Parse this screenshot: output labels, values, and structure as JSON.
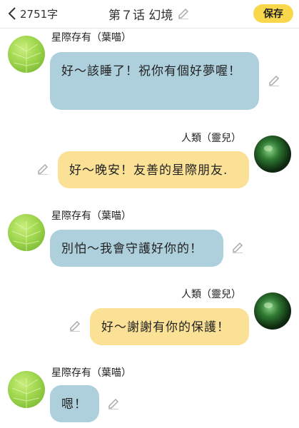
{
  "header": {
    "word_count": "2751字",
    "title": "第７话 幻境",
    "save_label": "保存"
  },
  "icons": {
    "back": "chevron-left-icon",
    "edit": "pencil-icon"
  },
  "colors": {
    "accent": "#f8d84a",
    "ai_bubble": "#aecfdc",
    "user_bubble": "#fbe195"
  },
  "messages": [
    {
      "side": "left",
      "speaker": "星際存有（葉喵）",
      "text": "好～該睡了！祝你有個好夢喔！"
    },
    {
      "side": "right",
      "speaker": "人類（靈兒）",
      "text": "好～晚安！友善的星際朋友."
    },
    {
      "side": "left",
      "speaker": "星際存有（葉喵）",
      "text": "別怕～我會守護好你的！"
    },
    {
      "side": "right",
      "speaker": "人類（靈兒）",
      "text": "好～謝謝有你的保護！"
    },
    {
      "side": "left",
      "speaker": "星際存有（葉喵）",
      "text": "嗯！"
    }
  ]
}
